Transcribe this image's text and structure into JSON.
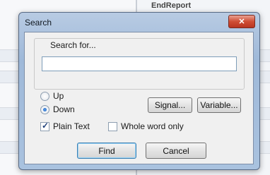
{
  "background": {
    "title": "EndReport"
  },
  "dialog": {
    "title": "Search",
    "group_label": "Search for...",
    "search_value": "",
    "direction": {
      "up_label": "Up",
      "down_label": "Down",
      "selected": "Down"
    },
    "signal_button": "Signal...",
    "variable_button": "Variable...",
    "plain_text": {
      "label": "Plain Text",
      "checked": true
    },
    "whole_word": {
      "label": "Whole word only",
      "checked": false
    },
    "find_button": "Find",
    "cancel_button": "Cancel",
    "close_symbol": "✕"
  },
  "colors": {
    "close_button": "#cf4d34",
    "title_bar": "#a9c2df"
  }
}
